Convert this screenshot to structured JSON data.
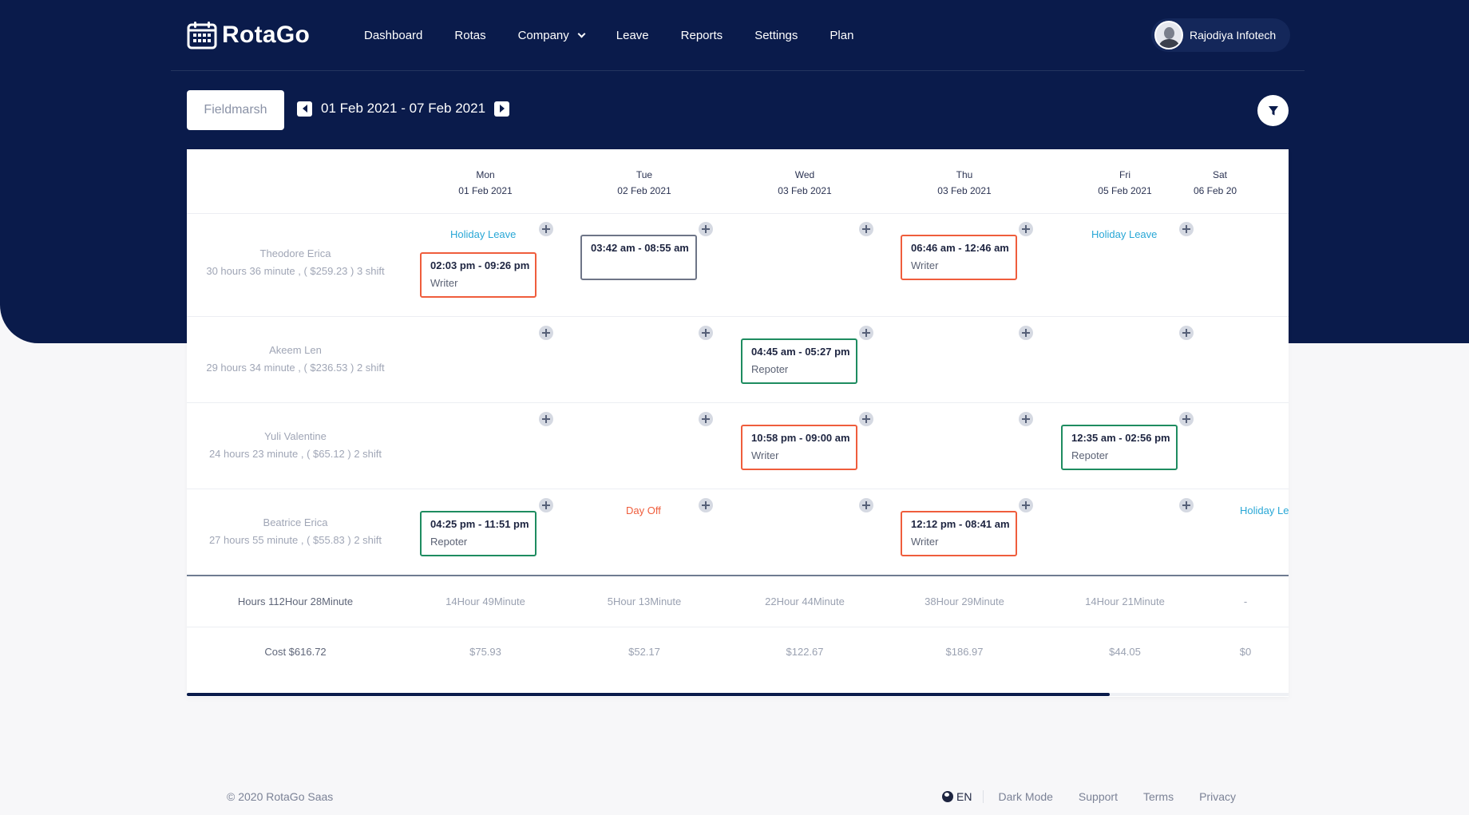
{
  "brand": {
    "name": "RotaGo"
  },
  "nav": {
    "items": [
      {
        "label": "Dashboard"
      },
      {
        "label": "Rotas"
      },
      {
        "label": "Company"
      },
      {
        "label": "Leave"
      },
      {
        "label": "Reports"
      },
      {
        "label": "Settings"
      },
      {
        "label": "Plan"
      }
    ],
    "user_name": "Rajodiya Infotech"
  },
  "toolbar": {
    "location": "Fieldmarsh",
    "date_range": "01 Feb 2021 - 07 Feb 2021",
    "prev_icon": "caret-left-icon",
    "next_icon": "caret-right-icon",
    "filter_icon": "filter-icon"
  },
  "days": [
    {
      "dow": "Mon",
      "date": "01 Feb 2021"
    },
    {
      "dow": "Tue",
      "date": "02 Feb 2021"
    },
    {
      "dow": "Wed",
      "date": "03 Feb 2021"
    },
    {
      "dow": "Thu",
      "date": "03 Feb 2021"
    },
    {
      "dow": "Fri",
      "date": "05 Feb 2021"
    },
    {
      "dow": "Sat",
      "date": "06 Feb 20"
    }
  ],
  "employees": [
    {
      "name": "Theodore Erica",
      "summary": "30 hours 36 minute , ( $259.23 ) 3 shift",
      "leave_mon": "Holiday Leave",
      "leave_fri": "Holiday Leave",
      "shifts": [
        {
          "time": "02:03 pm - 09:26 pm",
          "role": "Writer"
        },
        {
          "time": "03:42 am - 08:55 am",
          "role": ""
        },
        {
          "time": "06:46 am - 12:46 am",
          "role": "Writer"
        }
      ]
    },
    {
      "name": "Akeem Len",
      "summary": "29 hours 34 minute , ( $236.53 ) 2 shift",
      "shifts": [
        {
          "time": "04:45 am - 05:27 pm",
          "role": "Repoter"
        }
      ]
    },
    {
      "name": "Yuli Valentine",
      "summary": "24 hours 23 minute , ( $65.12 ) 2 shift",
      "shifts": [
        {
          "time": "10:58 pm - 09:00 am",
          "role": "Writer"
        },
        {
          "time": "12:35 am - 02:56 pm",
          "role": "Repoter"
        }
      ]
    },
    {
      "name": "Beatrice Erica",
      "summary": "27 hours 55 minute , ( $55.83 ) 2 shift",
      "dayoff_tue": "Day Off",
      "leave_sat": "Holiday Le",
      "shifts": [
        {
          "time": "04:25 pm - 11:51 pm",
          "role": "Repoter"
        },
        {
          "time": "12:12 pm - 08:41 am",
          "role": "Writer"
        }
      ]
    }
  ],
  "totals": {
    "hours_label": "Hours 112Hour 28Minute",
    "hours": [
      "14Hour 49Minute",
      "5Hour 13Minute",
      "22Hour 44Minute",
      "38Hour 29Minute",
      "14Hour 21Minute",
      "-"
    ],
    "cost_label": "Cost $616.72",
    "cost": [
      "$75.93",
      "$52.17",
      "$122.67",
      "$186.97",
      "$44.05",
      "$0"
    ]
  },
  "footer": {
    "copyright": "© 2020 RotaGo Saas",
    "lang": "EN",
    "links": [
      "Dark Mode",
      "Support",
      "Terms",
      "Privacy"
    ]
  },
  "colors": {
    "navy": "#0a1b4b",
    "shift_red": "#ef5d3c",
    "shift_green": "#1e8c60",
    "leave_blue": "#28a7d6"
  }
}
